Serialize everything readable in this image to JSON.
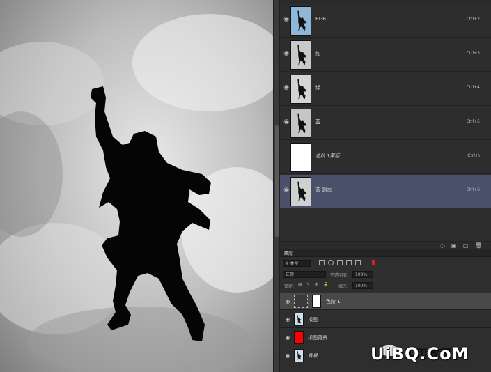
{
  "channels": {
    "items": [
      {
        "name": "RGB",
        "shortcut": "Ctrl+2",
        "visible": true,
        "selected": false,
        "italic": false
      },
      {
        "name": "红",
        "shortcut": "Ctrl+3",
        "visible": true,
        "selected": false,
        "italic": false
      },
      {
        "name": "绿",
        "shortcut": "Ctrl+4",
        "visible": true,
        "selected": false,
        "italic": false
      },
      {
        "name": "蓝",
        "shortcut": "Ctrl+5",
        "visible": true,
        "selected": false,
        "italic": false
      },
      {
        "name": "色阶 1蒙版",
        "shortcut": "Ctrl+\\",
        "visible": false,
        "selected": false,
        "italic": true
      },
      {
        "name": "蓝 副本",
        "shortcut": "Ctrl+6",
        "visible": true,
        "selected": true,
        "italic": false
      }
    ]
  },
  "layers": {
    "tab_label": "图层",
    "kind_filter": "类型",
    "blend_mode": "正常",
    "opacity_label": "不透明度:",
    "opacity_value": "100%",
    "lock_label": "锁定:",
    "fill_label": "填充:",
    "fill_value": "100%",
    "items": [
      {
        "name": "色阶 1",
        "type": "adjustment",
        "active": true
      },
      {
        "name": "扣图",
        "type": "image",
        "active": false
      },
      {
        "name": "扣图背景",
        "type": "red-fill",
        "active": false
      },
      {
        "name": "背景",
        "type": "image",
        "active": false,
        "italic": true
      }
    ]
  },
  "watermark": {
    "cn": "实用教程",
    "domain": "UiBQ.CoM"
  },
  "colors": {
    "selected_row": "#4a5069",
    "red_fill": "#ff0000"
  }
}
